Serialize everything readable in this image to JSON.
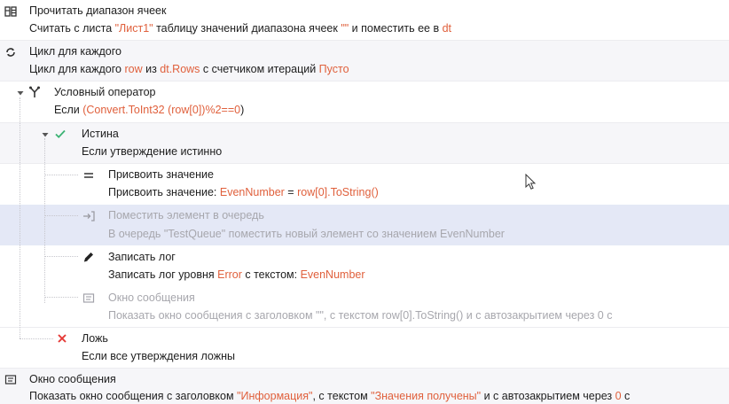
{
  "steps": {
    "read_range": {
      "title": "Прочитать диапазон ячеек",
      "d1": "Считать с листа ",
      "sheet": "\"Лист1\"",
      "d2": " таблицу значений диапазона ячеек ",
      "range": "\"\"",
      "d3": " и поместить ее в ",
      "target": "dt",
      "icon": "table-read-icon"
    },
    "foreach": {
      "title": "Цикл для каждого",
      "d1": "Цикл для каждого ",
      "var": "row",
      "d2": " из ",
      "collection": "dt.Rows",
      "d3": " с счетчиком итераций ",
      "counter": "Пусто",
      "icon": "loop-icon"
    },
    "if": {
      "title": "Условный оператор",
      "d1": "Если ",
      "cond_open": "(",
      "condition": "Convert.ToInt32 (row[0])%2==0",
      "cond_close": ")",
      "icon": "branch-icon"
    },
    "true_branch": {
      "title": "Истина",
      "desc": "Если утверждение истинно",
      "icon": "check-icon"
    },
    "assign": {
      "title": "Присвоить значение",
      "d1": "Присвоить значение: ",
      "var": "EvenNumber",
      "d2": " = ",
      "value": "row[0].ToString()",
      "icon": "equals-icon"
    },
    "enqueue": {
      "title": "Поместить элемент в очередь",
      "desc": "В очередь \"TestQueue\" поместить новый элемент со значением EvenNumber",
      "icon": "enqueue-icon"
    },
    "log": {
      "title": "Записать лог",
      "d1": "Записать лог уровня ",
      "level": "Error",
      "d2": " с текстом: ",
      "text": "EvenNumber",
      "icon": "pencil-icon"
    },
    "msgbox_inner": {
      "title": "Окно сообщения",
      "desc": "Показать окно сообщения с заголовком \"\", с текстом row[0].ToString() и с автозакрытием через 0 с",
      "icon": "message-icon"
    },
    "false_branch": {
      "title": "Ложь",
      "desc": "Если все утверждения ложны",
      "icon": "cross-icon"
    },
    "msgbox_outer": {
      "title": "Окно сообщения",
      "d1": "Показать окно сообщения с заголовком ",
      "caption": "\"Информация\"",
      "d2": ", с текстом ",
      "text": "\"Значения получены\"",
      "d3": " и с автозакрытием через ",
      "delay": "0",
      "d4": " с",
      "icon": "message-icon"
    }
  },
  "colors": {
    "value": "#e0603c",
    "selected_row": "#e4e8f6",
    "disabled_text": "#a7a7ad",
    "check": "#3bb273",
    "cross": "#e53935"
  }
}
